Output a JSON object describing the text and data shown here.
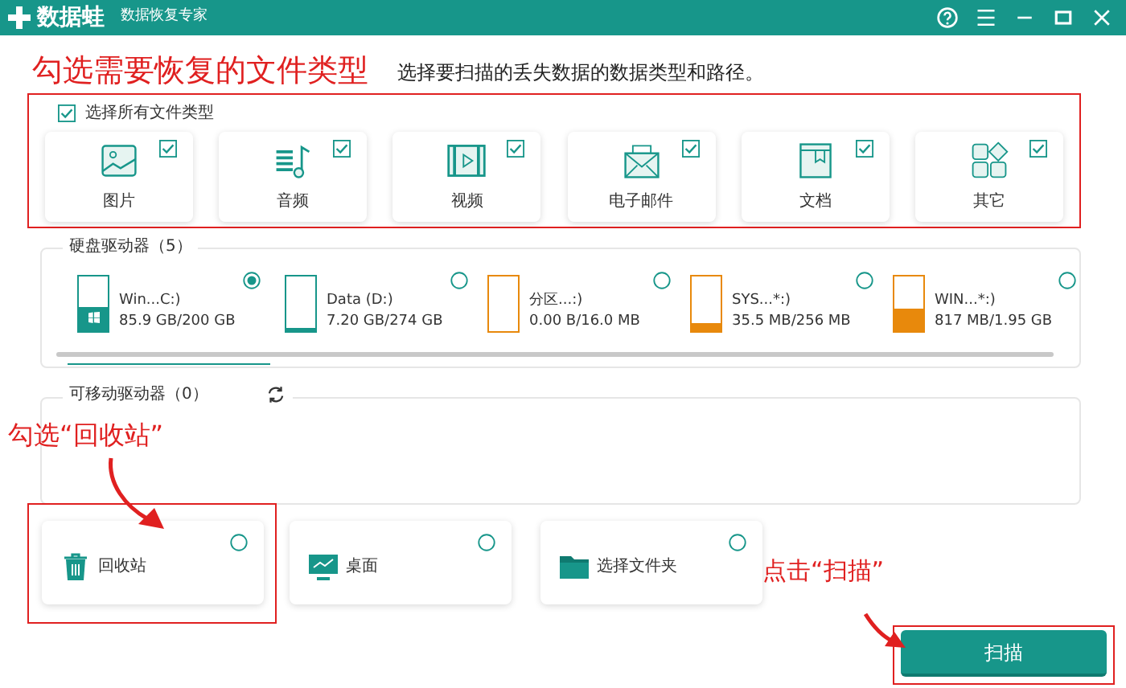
{
  "app": {
    "name": "数据蛙",
    "subtitle": "数据恢复专家"
  },
  "annotations": [
    {
      "kind": "heading",
      "text": "勾选需要恢复的文件类型"
    },
    {
      "kind": "recycle",
      "text": "勾选“回收站”"
    },
    {
      "kind": "scan",
      "text": "点击“扫描”"
    }
  ],
  "instruction": "选择要扫描的丢失数据的数据类型和路径。",
  "file_types": {
    "select_all": {
      "label": "选择所有文件类型",
      "checked": true
    },
    "items": [
      {
        "kind": "image",
        "label": "图片",
        "checked": true
      },
      {
        "kind": "audio",
        "label": "音频",
        "checked": true
      },
      {
        "kind": "video",
        "label": "视频",
        "checked": true
      },
      {
        "kind": "email",
        "label": "电子邮件",
        "checked": true
      },
      {
        "kind": "document",
        "label": "文档",
        "checked": true
      },
      {
        "kind": "other",
        "label": "其它",
        "checked": true
      }
    ]
  },
  "hard_drives": {
    "title": "硬盘驱动器（5）",
    "items": [
      {
        "name": "Win...C:)",
        "usage": "85.9 GB/200 GB",
        "level": 0.43,
        "color": "#17968a",
        "system": true,
        "selected": true
      },
      {
        "name": "Data (D:)",
        "usage": "7.20 GB/274 GB",
        "level": 0.03,
        "color": "#17968a",
        "system": false,
        "selected": false
      },
      {
        "name": "分区...:)",
        "usage": "0.00  B/16.0 MB",
        "level": 0,
        "color": "#e8890c",
        "system": false,
        "selected": false
      },
      {
        "name": "SYS...*:)",
        "usage": "35.5 MB/256 MB",
        "level": 0.14,
        "color": "#e8890c",
        "system": false,
        "selected": false
      },
      {
        "name": "WIN...*:)",
        "usage": "817 MB/1.95 GB",
        "level": 0.42,
        "color": "#e8890c",
        "system": false,
        "selected": false
      }
    ]
  },
  "removable_drives": {
    "title": "可移动驱动器（0）"
  },
  "locations": [
    {
      "kind": "recycle-bin",
      "label": "回收站",
      "selected": false
    },
    {
      "kind": "desktop",
      "label": "桌面",
      "selected": false
    },
    {
      "kind": "folder",
      "label": "选择文件夹",
      "selected": false
    }
  ],
  "scan_button": "扫描"
}
